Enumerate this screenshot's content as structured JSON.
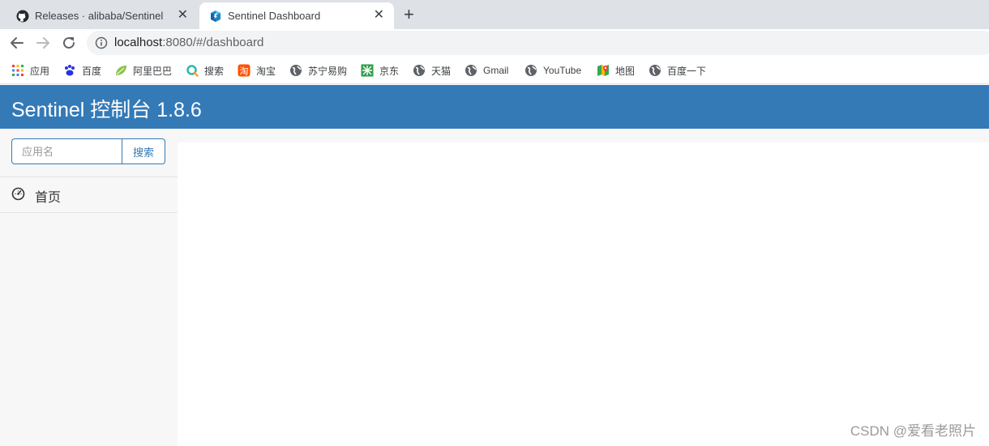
{
  "browser": {
    "tabs": [
      {
        "title": "Releases · alibaba/Sentinel",
        "favicon": "github-icon",
        "active": false
      },
      {
        "title": "Sentinel Dashboard",
        "favicon": "sentinel-icon",
        "active": true
      }
    ],
    "close_glyph": "✕",
    "new_tab_glyph": "+",
    "url_host": "localhost",
    "url_rest": ":8080/#/dashboard",
    "bookmarks": [
      {
        "label": "应用",
        "icon": "apps-grid-icon"
      },
      {
        "label": "百度",
        "icon": "baidu-paw-icon"
      },
      {
        "label": "阿里巴巴",
        "icon": "leaf-icon"
      },
      {
        "label": "搜索",
        "icon": "search-ring-icon"
      },
      {
        "label": "淘宝",
        "icon": "taobao-icon"
      },
      {
        "label": "苏宁易购",
        "icon": "globe-icon"
      },
      {
        "label": "京东",
        "icon": "jd-icon"
      },
      {
        "label": "天猫",
        "icon": "globe-icon"
      },
      {
        "label": "Gmail",
        "icon": "globe-icon"
      },
      {
        "label": "YouTube",
        "icon": "globe-icon"
      },
      {
        "label": "地图",
        "icon": "maps-icon"
      },
      {
        "label": "百度一下",
        "icon": "globe-icon"
      }
    ]
  },
  "app": {
    "title": "Sentinel 控制台 1.8.6",
    "accent": "#337ab7",
    "search": {
      "placeholder": "应用名",
      "button_label": "搜索"
    },
    "sidebar": {
      "items": [
        {
          "label": "首页",
          "icon": "dashboard-gauge-icon"
        }
      ]
    }
  },
  "watermark": "CSDN @爱看老照片"
}
